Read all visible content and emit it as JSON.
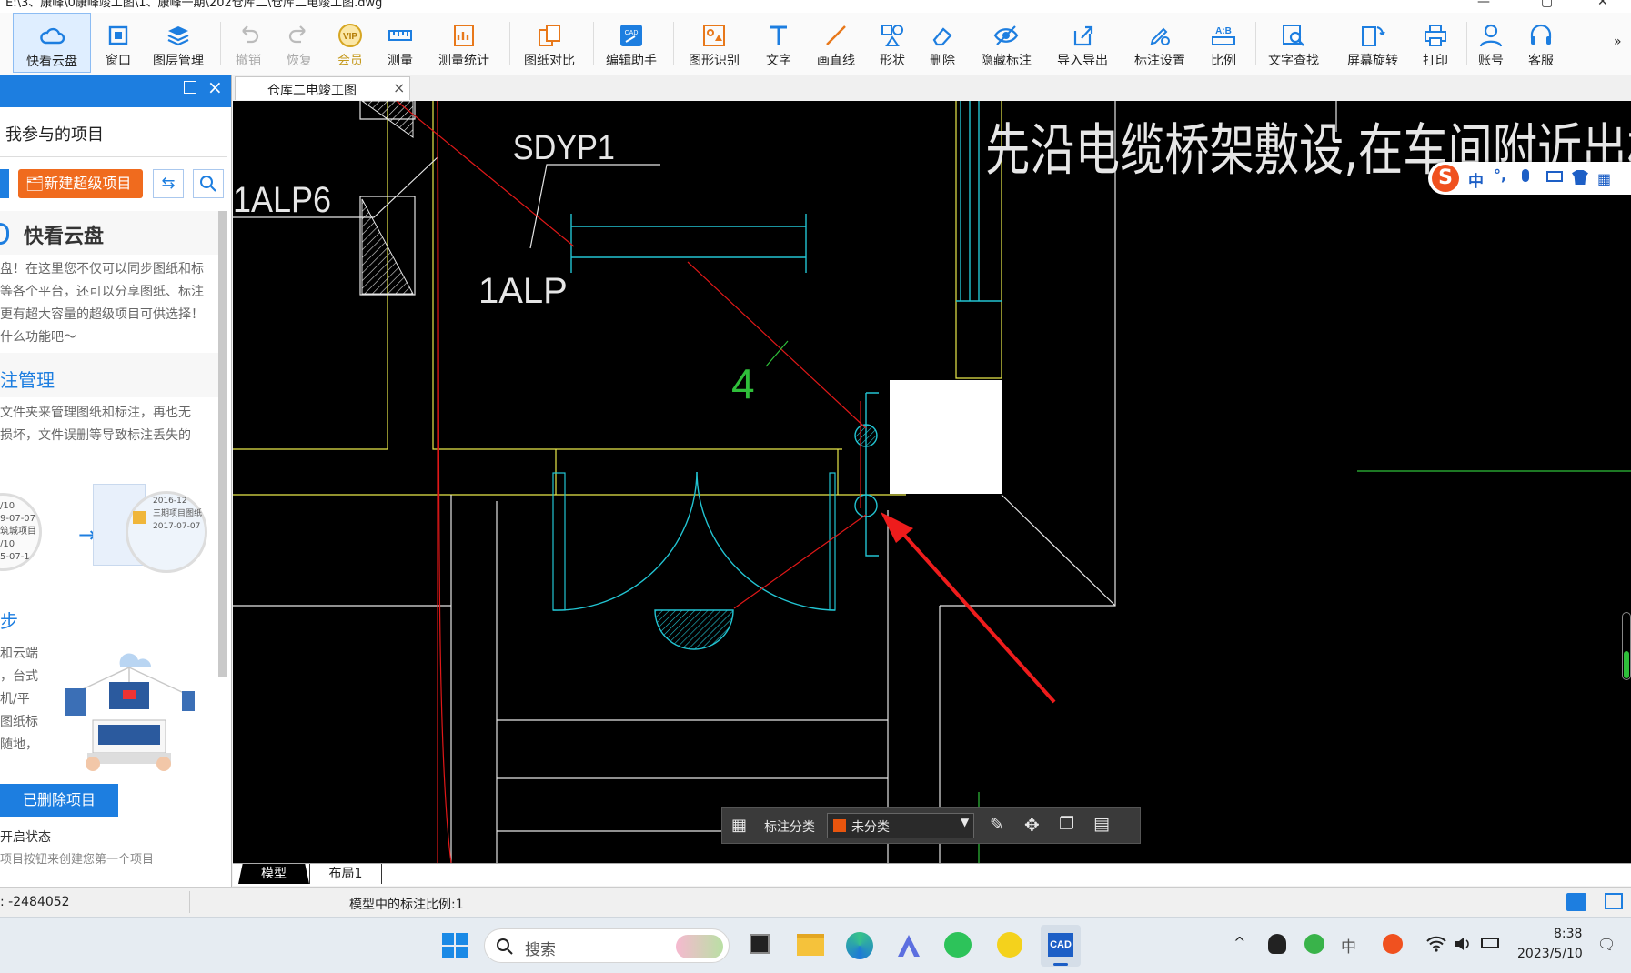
{
  "window": {
    "title": "E:\\3、康峰\\0康峰竣工图\\1、康峰一期\\202仓库二\\仓库二电竣工图.dwg",
    "controls": [
      "—",
      "▢",
      "✕"
    ]
  },
  "toolbar": {
    "items": [
      {
        "label": "快看云盘",
        "icon": "cloud-icon",
        "active": true
      },
      {
        "label": "窗口",
        "icon": "window-icon"
      },
      {
        "label": "图层管理",
        "icon": "layers-icon"
      },
      {
        "label": "撤销",
        "icon": "undo-icon",
        "disabled": true
      },
      {
        "label": "恢复",
        "icon": "redo-icon",
        "disabled": true
      },
      {
        "label": "会员",
        "icon": "vip-icon",
        "badge": "VIP"
      },
      {
        "label": "测量",
        "icon": "ruler-icon"
      },
      {
        "label": "测量统计",
        "icon": "measure-stats-icon"
      },
      {
        "label": "图纸对比",
        "icon": "compare-icon"
      },
      {
        "label": "编辑助手",
        "icon": "cad-edit-icon",
        "badge": "CAD"
      },
      {
        "label": "图形识别",
        "icon": "shape-recognize-icon"
      },
      {
        "label": "文字",
        "icon": "text-icon"
      },
      {
        "label": "画直线",
        "icon": "line-icon"
      },
      {
        "label": "形状",
        "icon": "shapes-icon"
      },
      {
        "label": "删除",
        "icon": "eraser-icon"
      },
      {
        "label": "隐藏标注",
        "icon": "eye-hide-icon"
      },
      {
        "label": "导入导出",
        "icon": "import-export-icon"
      },
      {
        "label": "标注设置",
        "icon": "annotation-settings-icon"
      },
      {
        "label": "比例",
        "icon": "scale-icon",
        "badge": "A:B"
      },
      {
        "label": "文字查找",
        "icon": "text-search-icon"
      },
      {
        "label": "屏幕旋转",
        "icon": "rotate-screen-icon"
      },
      {
        "label": "打印",
        "icon": "printer-icon"
      },
      {
        "label": "账号",
        "icon": "user-icon"
      },
      {
        "label": "客服",
        "icon": "headset-icon"
      }
    ],
    "more": "»"
  },
  "sidebar": {
    "section_title": "我参与的项目",
    "new_project_button": "新建超级项目",
    "promo_title": "快看云盘",
    "promo_text": [
      "盘！在这里您不仅可以同步图纸和标",
      "等各个平台，还可以分享图纸、标注",
      "更有超大容量的超级项目可供选择！",
      "什么功能吧～"
    ],
    "feature2_title": "注管理",
    "feature2_text": [
      "文件夹来管理图纸和标注，再也无",
      "损坏，文件误删等导致标注丢失的"
    ],
    "illus_left_lines": [
      "/10",
      "9-07-07",
      "筑城项目",
      "/10",
      "5-07-1"
    ],
    "illus_right_lines": [
      "2016-12",
      "三期项目图纸",
      "2017-07-07"
    ],
    "feature3_title": "步",
    "feature3_text": [
      "和云端",
      "，台式",
      "机/平",
      "图纸标",
      "随地，"
    ],
    "deleted_button": "已删除项目",
    "status_label": "开启状态",
    "hint": "项目按钮来创建您第一个项目"
  },
  "tabs": {
    "document_tab": "仓库二电竣工图",
    "close": "×",
    "layout_tabs": [
      "模型",
      "布局1"
    ]
  },
  "drawing": {
    "labels": {
      "sdyp1": "SDYP1",
      "alp6": "1ALP6",
      "alp": "1ALP",
      "num4": "4",
      "note": "先沿电缆桥架敷设,在车间附近出桥架套钢"
    }
  },
  "annotation_bar": {
    "category_label": "标注分类",
    "category_value": "未分类",
    "category_color": "#e8550e"
  },
  "ime": {
    "lang": "中",
    "punct": "°,"
  },
  "statusbar": {
    "coord": "-2484052",
    "scale_text": "模型中的标注比例:1"
  },
  "taskbar": {
    "search_placeholder": "搜索",
    "tray_lang": "中",
    "time": "8:38",
    "date": "2023/5/10"
  }
}
